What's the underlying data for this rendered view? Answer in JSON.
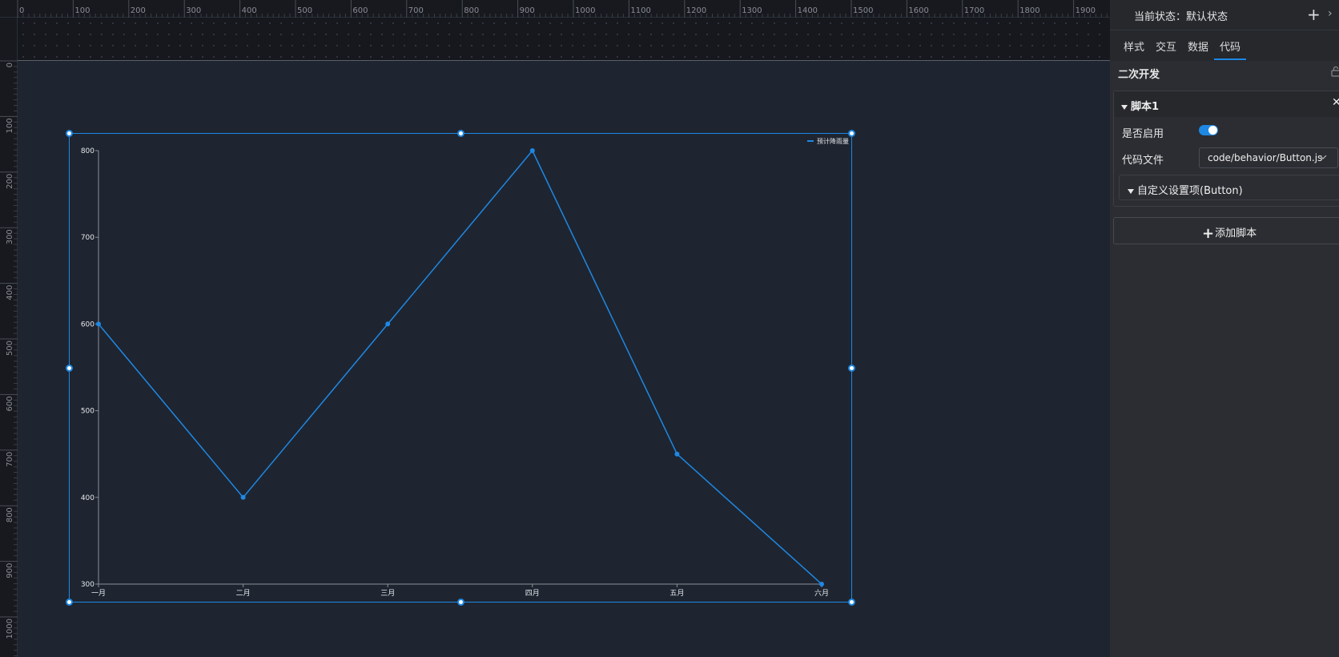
{
  "rulers": {
    "top_labels": [
      "0",
      "100",
      "200",
      "300",
      "400",
      "500",
      "600",
      "700",
      "800",
      "900",
      "1000",
      "1100",
      "1200",
      "1300",
      "1400",
      "1500",
      "1600",
      "1700",
      "1800",
      "1900"
    ],
    "left_labels": [
      "0",
      "100",
      "200",
      "300",
      "400",
      "500",
      "600",
      "700",
      "800",
      "900",
      "1000"
    ]
  },
  "colors": {
    "accent": "#1e88e5",
    "canvas_bg": "#1e2530",
    "panel_bg": "#2b2d32"
  },
  "chart_data": {
    "type": "line",
    "categories": [
      "一月",
      "二月",
      "三月",
      "四月",
      "五月",
      "六月"
    ],
    "series": [
      {
        "name": "预计降雨量",
        "values": [
          600,
          400,
          600,
          800,
          450,
          300
        ],
        "color": "#1e88e5"
      }
    ],
    "yticks": [
      "300",
      "400",
      "500",
      "600",
      "700",
      "800"
    ],
    "ylim": [
      300,
      800
    ],
    "title": "",
    "xlabel": "",
    "ylabel": "",
    "legend_position": "top-right",
    "grid": false
  },
  "panel": {
    "state_label": "当前状态：默认状态",
    "add_icon": "plus-icon",
    "more_icon": "chevron-right-icon",
    "tabs": [
      {
        "label": "样式",
        "active": false
      },
      {
        "label": "交互",
        "active": false
      },
      {
        "label": "数据",
        "active": false
      },
      {
        "label": "代码",
        "active": true
      }
    ],
    "dev_title": "二次开发",
    "script": {
      "title": "脚本1",
      "close_icon": "close-icon",
      "enable_label": "是否启用",
      "enabled": true,
      "file_label": "代码文件",
      "file_value": "code/behavior/Button.js",
      "custom_section": "自定义设置项(Button)"
    },
    "add_script_label": "添加脚本"
  }
}
